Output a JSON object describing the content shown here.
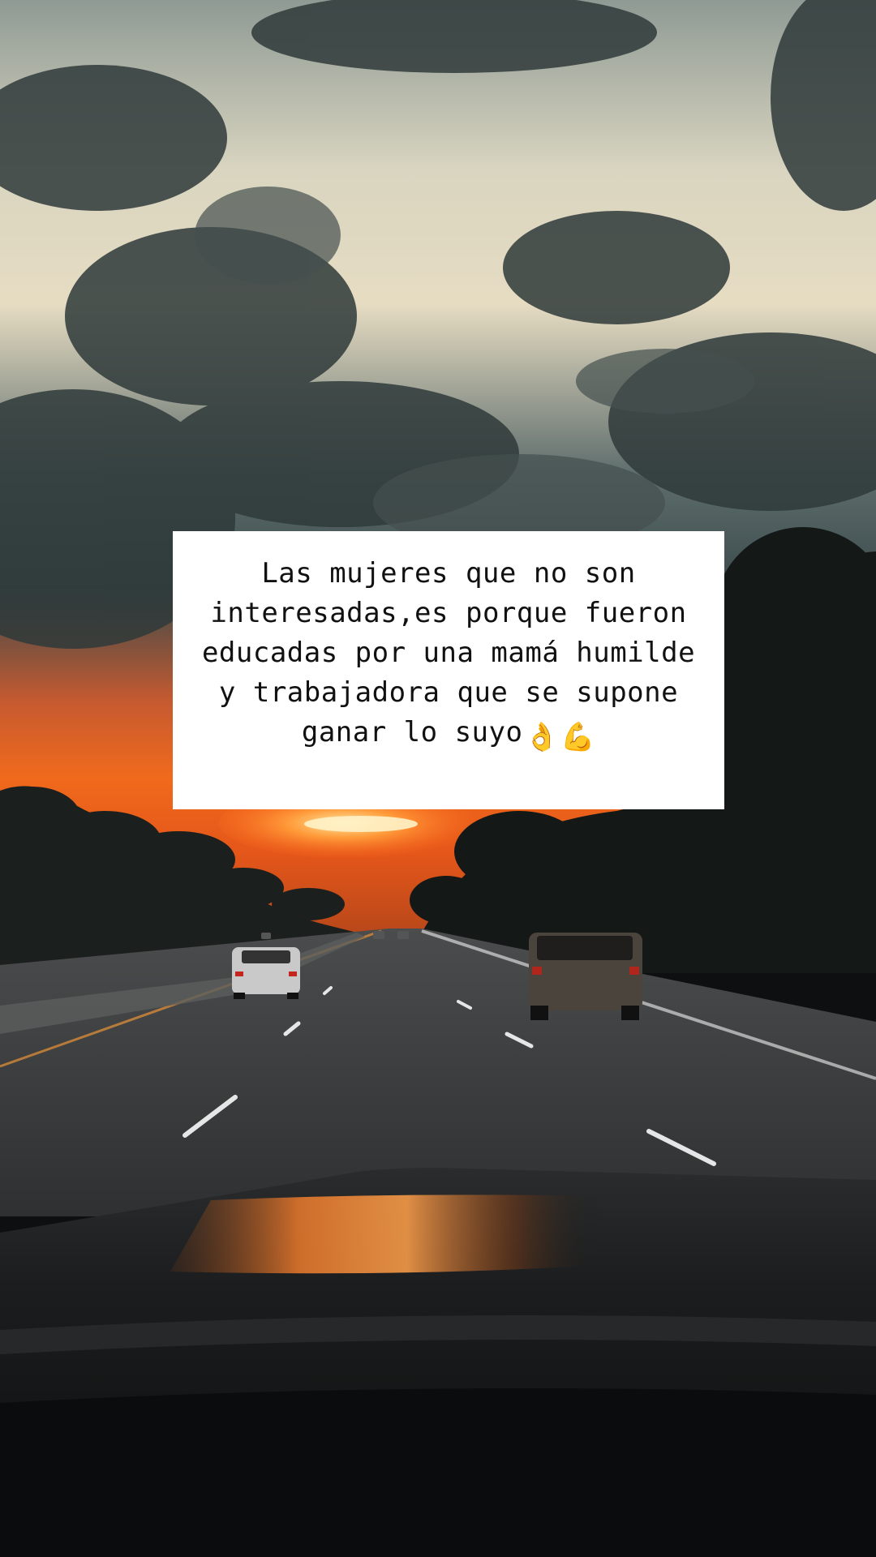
{
  "caption": {
    "text": "Las mujeres que no son interesadas,es porque fueron educadas por una mamá humilde y trabajadora que se supone ganar lo suyo",
    "emojis": [
      "ok-hand-emoji",
      "flexed-biceps-emoji"
    ]
  },
  "colors": {
    "sky_light": "#e8e2cc",
    "cloud_dark": "#2f3a3a",
    "sunset_orange": "#f06a1c",
    "road": "#3b3d3e",
    "hood": "#141617"
  }
}
